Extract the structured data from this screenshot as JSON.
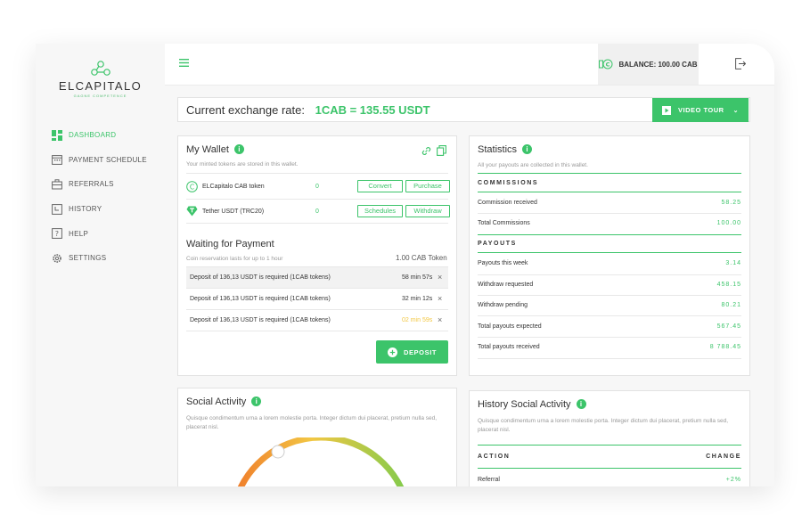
{
  "brand": {
    "name": "ELCAPITALO",
    "tagline": "GAGNE COMPETENCE"
  },
  "sidebar": {
    "items": [
      {
        "label": "DASHBOARD",
        "icon": "grid-icon"
      },
      {
        "label": "PAYMENT SCHEDULE",
        "icon": "calendar-icon"
      },
      {
        "label": "REFERRALS",
        "icon": "briefcase-icon"
      },
      {
        "label": "HISTORY",
        "icon": "history-icon"
      },
      {
        "label": "HELP",
        "icon": "help-icon"
      },
      {
        "label": "SETTINGS",
        "icon": "gear-icon"
      }
    ]
  },
  "topbar": {
    "balance": "BALANCE: 100.00 CAB"
  },
  "rate": {
    "label": "Current exchange rate:",
    "value": "1CAB = 135.55 USDT"
  },
  "tour": {
    "label": "VIDEO TOUR"
  },
  "wallet": {
    "title": "My Wallet",
    "subtitle": "Your minted tokens are stored in this wallet.",
    "tokens": [
      {
        "name": "ELCapitalo CAB token",
        "amount": "0",
        "btn1": "Convert",
        "btn2": "Purchase"
      },
      {
        "name": "Tether USDT (TRC20)",
        "amount": "0",
        "btn1": "Schedules",
        "btn2": "Withdraw"
      }
    ]
  },
  "waiting": {
    "title": "Waiting for Payment",
    "subtitle": "Coin reservation lasts for up to 1 hour",
    "amount": "1.00 CAB Token",
    "rows": [
      {
        "text": "Deposit of 136,13 USDT is required (1CAB tokens)",
        "time": "58 min 57s"
      },
      {
        "text": "Deposit of 136,13 USDT is required (1CAB tokens)",
        "time": "32 min 12s"
      },
      {
        "text": "Deposit of 136,13 USDT is required (1CAB tokens)",
        "time": "02 min 59s"
      }
    ],
    "deposit_label": "DEPOSIT"
  },
  "statistics": {
    "title": "Statistics",
    "subtitle": "All your payouts are collected in this wallet.",
    "commissions_head": "COMMISSIONS",
    "commissions": [
      {
        "label": "Commission received",
        "value": "58.25"
      },
      {
        "label": "Total Commissions",
        "value": "100.00"
      }
    ],
    "payouts_head": "PAYOUTS",
    "payouts": [
      {
        "label": "Payouts this week",
        "value": "3.14"
      },
      {
        "label": "Withdraw requested",
        "value": "458.15"
      },
      {
        "label": "Withdraw pending",
        "value": "80.21"
      },
      {
        "label": "Total payouts expected",
        "value": "567.45"
      },
      {
        "label": "Total payouts received",
        "value": "8 788.45"
      }
    ]
  },
  "social": {
    "title": "Social Activity",
    "text": "Quisque condimentum urna a lorem molestie porta. Integer dictum dui placerat, pretium nulla sed, placerat nisl."
  },
  "history_social": {
    "title": "History Social Activity",
    "text": "Quisque condimentum urna a lorem molestie porta. Integer dictum dui placerat, pretium nulla sed, placerat nisl.",
    "col_action": "ACTION",
    "col_change": "CHANGE",
    "rows": [
      {
        "action": "Referral",
        "change": "+2%"
      }
    ]
  },
  "colors": {
    "accent": "#3cc46a",
    "warning": "#f2c744"
  }
}
